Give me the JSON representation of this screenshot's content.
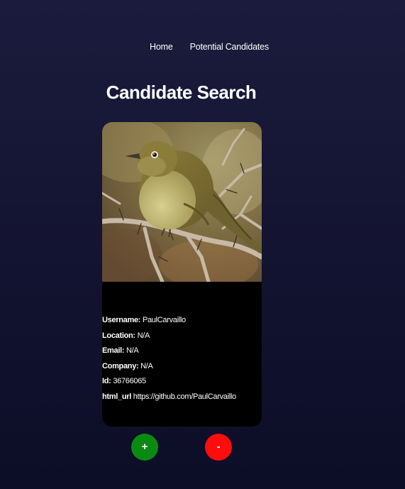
{
  "nav": {
    "home": "Home",
    "potential": "Potential Candidates"
  },
  "page": {
    "title": "Candidate Search"
  },
  "candidate": {
    "username_label": "Username:",
    "username": "PaulCarvaillo",
    "location_label": "Location:",
    "location": "N/A",
    "email_label": "Email:",
    "email": "N/A",
    "company_label": "Company:",
    "company": "N/A",
    "id_label": "Id:",
    "id": "36766065",
    "url_label": "html_url",
    "url": "https://github.com/PaulCarvaillo"
  },
  "actions": {
    "add": "+",
    "reject": "-"
  },
  "colors": {
    "background_top": "#1b1b3d",
    "background_bottom": "#0c0d26",
    "card": "#000000",
    "add": "#0a8a12",
    "reject": "#ff0d0d"
  }
}
